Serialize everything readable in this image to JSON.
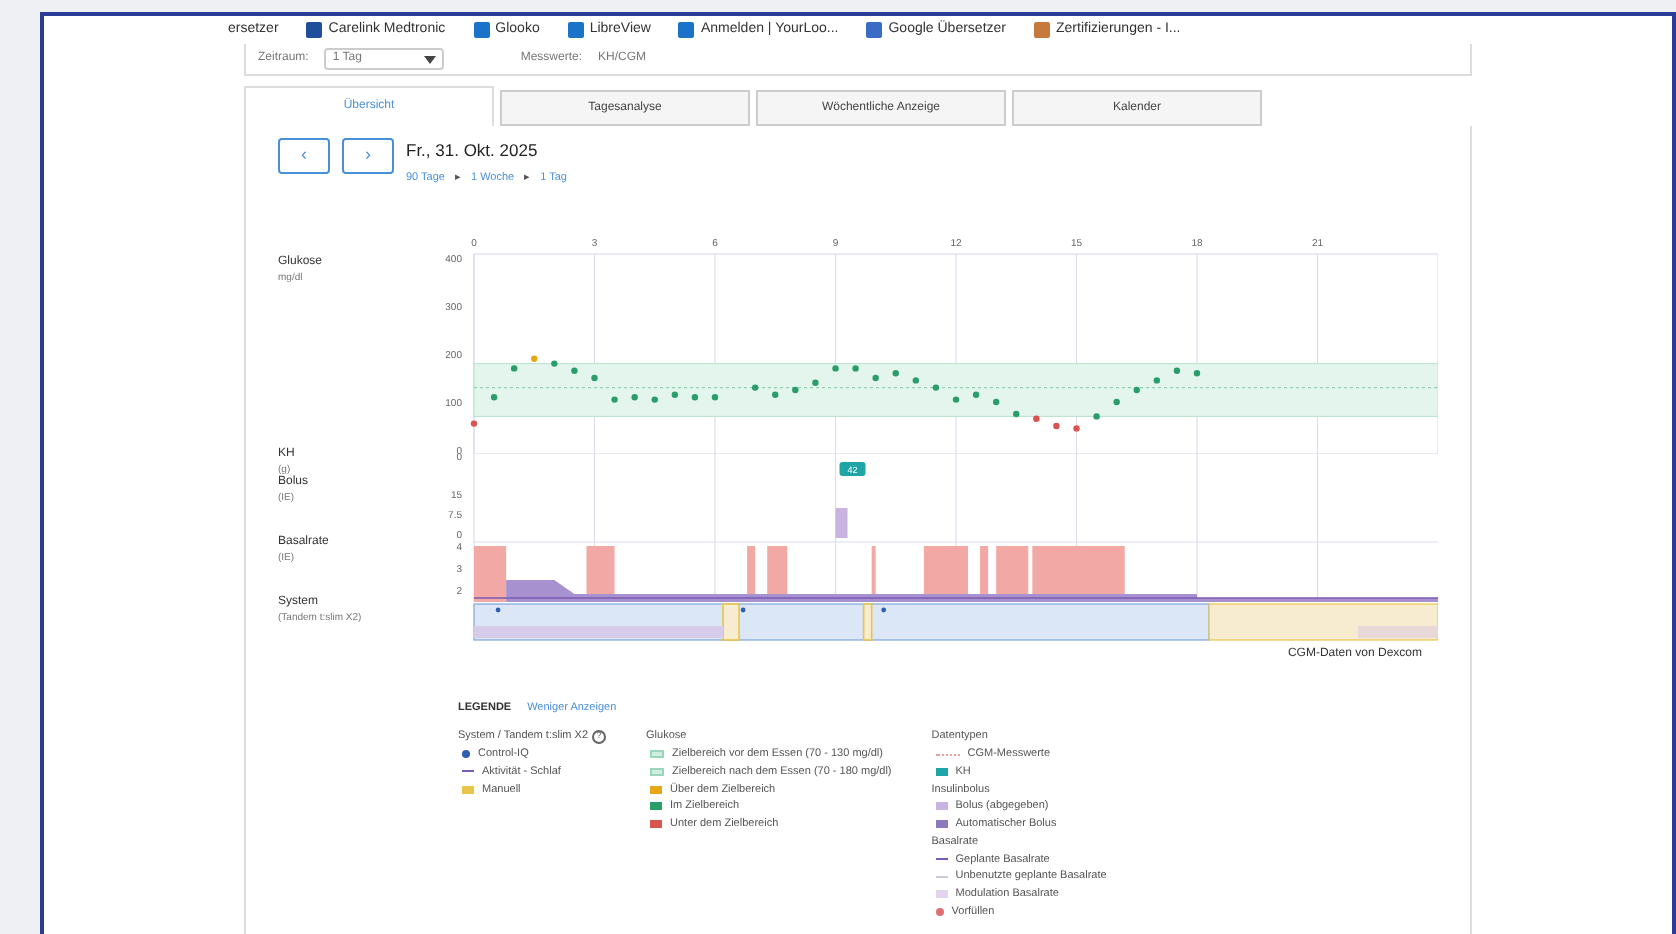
{
  "bookmarks": [
    {
      "label": "ersetzer",
      "kind": "text"
    },
    {
      "label": "Carelink Medtronic",
      "kind": "tile",
      "color": "#1f4e9b"
    },
    {
      "label": "Glooko",
      "kind": "tile",
      "color": "#1a73c9"
    },
    {
      "label": "LibreView",
      "kind": "tile",
      "color": "#1a73c9"
    },
    {
      "label": "Anmelden | YourLoo...",
      "kind": "tile",
      "color": "#1a73c9"
    },
    {
      "label": "Google Übersetzer",
      "kind": "tile",
      "color": "#3b6cc5"
    },
    {
      "label": "Zertifizierungen - I...",
      "kind": "tile",
      "color": "#c57a3b"
    }
  ],
  "filters": {
    "period_label": "Zeitraum:",
    "period_value": "1 Tag",
    "readings_label": "Messwerte:",
    "readings_value": "KH/CGM"
  },
  "tabs": [
    {
      "label": "Übersicht",
      "selected": true
    },
    {
      "label": "Tagesanalyse",
      "selected": false
    },
    {
      "label": "Wöchentliche Anzeige",
      "selected": false
    },
    {
      "label": "Kalender",
      "selected": false
    }
  ],
  "nav": {
    "prev": "‹",
    "next": "›",
    "date": "Fr., 31. Okt. 2025",
    "crumbs": [
      "90 Tage",
      "1 Woche",
      "1 Tag"
    ],
    "separator": "▸"
  },
  "rows": [
    {
      "title": "Glukose",
      "unit": "mg/dl"
    },
    {
      "title": "KH",
      "unit": "(g)"
    },
    {
      "title": "Bolus",
      "unit": "(IE)"
    },
    {
      "title": "Basalrate",
      "unit": "(IE)"
    },
    {
      "title": "System",
      "unit": "(Tandem t:slim X2)"
    }
  ],
  "glucose": {
    "chart_data": {
      "type": "scatter",
      "grid": true,
      "xticks": [
        0,
        3,
        6,
        9,
        12,
        15,
        18,
        21
      ],
      "yticks": [
        0,
        100,
        200,
        300,
        400
      ],
      "ylim": [
        0,
        400
      ],
      "xlim": [
        0,
        24
      ],
      "bands": [
        {
          "from": 70,
          "to": 180,
          "axis": "y",
          "color": "#e3f5ec"
        }
      ],
      "ref_lines": [
        {
          "value": 130,
          "axis": "y",
          "color": "#8fcfb0"
        }
      ],
      "x": [
        0,
        0.5,
        1,
        1.5,
        2,
        2.5,
        3,
        3.5,
        4,
        4.5,
        5,
        5.5,
        6,
        7,
        7.5,
        8,
        8.5,
        9,
        9.5,
        10,
        10.5,
        11,
        11.5,
        12,
        12.5,
        13,
        13.5,
        14,
        14.5,
        15,
        15.5,
        16,
        16.5,
        17,
        17.5,
        18
      ],
      "series": [
        {
          "color": "#2a9d6a",
          "values": [
            null,
            110,
            170,
            null,
            180,
            165,
            150,
            105,
            110,
            105,
            115,
            110,
            110,
            130,
            115,
            125,
            140,
            170,
            170,
            150,
            160,
            145,
            130,
            105,
            115,
            100,
            75,
            null,
            null,
            null,
            70,
            100,
            125,
            145,
            165,
            160
          ]
        },
        {
          "color": "#d9534f",
          "values": [
            55,
            null,
            null,
            null,
            null,
            null,
            null,
            null,
            null,
            null,
            null,
            null,
            null,
            null,
            null,
            null,
            null,
            null,
            null,
            null,
            null,
            null,
            null,
            null,
            null,
            null,
            null,
            65,
            50,
            45,
            null,
            null,
            null,
            null,
            null,
            null
          ]
        },
        {
          "color": "#e6a817",
          "values": [
            null,
            null,
            null,
            190,
            null,
            null,
            null,
            null,
            null,
            null,
            null,
            null,
            null,
            null,
            null,
            null,
            null,
            null,
            null,
            null,
            null,
            null,
            null,
            null,
            null,
            null,
            null,
            null,
            null,
            null,
            null,
            null,
            null,
            null,
            null,
            null
          ]
        }
      ]
    }
  },
  "kh_badge": "42",
  "bolus_ticks": [
    "15",
    "7.5",
    "0"
  ],
  "basal_ticks": [
    "4",
    "3",
    "2"
  ],
  "kh_tick": "0",
  "source_note": "CGM-Daten von Dexcom",
  "legend": {
    "title": "LEGENDE",
    "toggle": "Weniger Anzeigen",
    "columns": [
      {
        "heading": "System / Tandem t:slim X2",
        "info": "?",
        "items": [
          {
            "label": "Control-IQ",
            "kind": "dot",
            "color": "#2f5fb3"
          },
          {
            "label": "Aktivität - Schlaf",
            "kind": "dash",
            "color": "#7a5bb5"
          },
          {
            "label": "Manuell",
            "kind": "square",
            "color": "#e8c547"
          }
        ]
      },
      {
        "heading": "Glukose",
        "items": [
          {
            "label": "Zielbereich vor dem Essen (70 - 130 mg/dl)",
            "kind": "band",
            "color": "#cdeee0"
          },
          {
            "label": "Zielbereich nach dem Essen (70 - 180 mg/dl)",
            "kind": "band",
            "color": "#cdeee0"
          },
          {
            "label": "Über dem Zielbereich",
            "kind": "square",
            "color": "#e6a817"
          },
          {
            "label": "Im Zielbereich",
            "kind": "square",
            "color": "#2a9d6a"
          },
          {
            "label": "Unter dem Zielbereich",
            "kind": "square",
            "color": "#d9534f"
          }
        ]
      },
      {
        "heading": "Datentypen",
        "items": [
          {
            "label": "CGM-Messwerte",
            "kind": "dots",
            "color": "#e8a0a0"
          },
          {
            "label": "KH",
            "kind": "square",
            "color": "#1fa5a5"
          },
          {
            "label": "Insulinbolus",
            "kind": "subheading"
          },
          {
            "label": "Bolus (abgegeben)",
            "kind": "square",
            "color": "#c9b3e0"
          },
          {
            "label": "Automatischer Bolus",
            "kind": "square",
            "color": "#8c7bb8"
          },
          {
            "label": "Basalrate",
            "kind": "subheading"
          },
          {
            "label": "Geplante Basalrate",
            "kind": "dash",
            "color": "#7a5bb5"
          },
          {
            "label": "Unbenutzte geplante Basalrate",
            "kind": "dash",
            "color": "#c9c9d9"
          },
          {
            "label": "Modulation Basalrate",
            "kind": "square",
            "color": "#e3d3ef"
          },
          {
            "label": "Vorfüllen",
            "kind": "dot",
            "color": "#e07070"
          }
        ]
      }
    ]
  }
}
